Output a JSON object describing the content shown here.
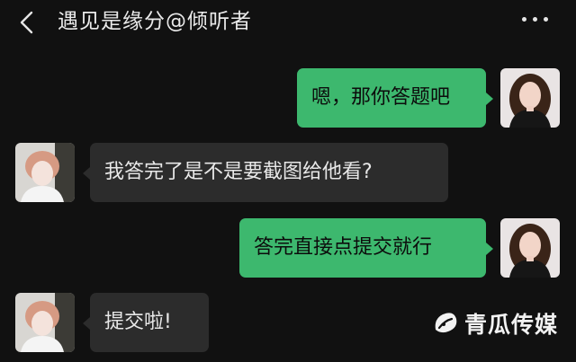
{
  "header": {
    "title": "遇见是缘分@倾听者",
    "back_icon": "chevron-left-icon",
    "more_icon": "more-horizontal-icon"
  },
  "messages": [
    {
      "sender": "self",
      "text": "嗯，那你答题吧"
    },
    {
      "sender": "other",
      "text": "我答完了是不是要截图给他看?"
    },
    {
      "sender": "self",
      "text": "答完直接点提交就行"
    },
    {
      "sender": "other",
      "text": "提交啦!"
    }
  ],
  "watermark": {
    "text": "青瓜传媒",
    "logo": "qinggua-logo-icon"
  },
  "colors": {
    "background": "#111111",
    "outgoing_bubble": "#3db86e",
    "incoming_bubble": "#2c2c2c"
  }
}
